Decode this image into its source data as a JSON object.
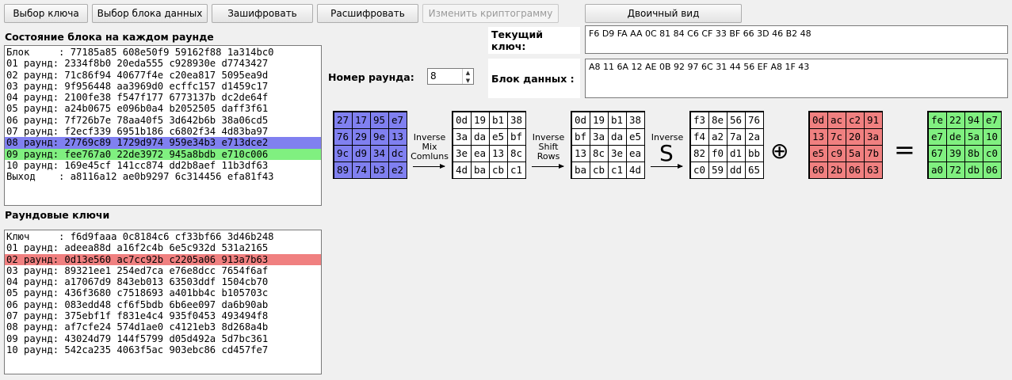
{
  "toolbar": {
    "select_key": "Выбор ключа",
    "select_block": "Выбор блока данных",
    "encrypt": "Зашифровать",
    "decrypt": "Расшифровать",
    "edit_cryptogram": "Изменить криптограмму",
    "binary_view": "Двоичный вид"
  },
  "state_panel": {
    "title": "Состояние блока на каждом раунде",
    "rows": [
      "Блок     : 77185a85 608e50f9 59162f88 1a314bc0",
      "01 раунд: 2334f8b0 20eda555 c928930e d7743427",
      "02 раунд: 71c86f94 40677f4e c20ea817 5095ea9d",
      "03 раунд: 9f956448 aa3969d0 ecffc157 d1459c17",
      "04 раунд: 2100fe38 f547f177 6773137b dc2de64f",
      "05 раунд: a24b0675 e096b0a4 b2052505 daff3f61",
      "06 раунд: 7f726b7e 78aa40f5 3d642b6b 38a06cd5",
      "07 раунд: f2ecf339 6951b186 c6802f34 4d83ba97",
      "08 раунд: 27769c89 1729d974 959e34b3 e713dce2",
      "09 раунд: fee767a0 22de3972 945a8bdb e710c006",
      "10 раунд: 169e45cf 141cc874 dd2b8aef 11b3df63",
      "Выход    : a8116a12 ae0b9297 6c314456 efa81f43"
    ]
  },
  "keys_panel": {
    "title": "Раундовые ключи",
    "rows": [
      "Ключ     : f6d9faaa 0c8184c6 cf33bf66 3d46b248",
      "01 раунд: adeea88d a16f2c4b 6e5c932d 531a2165",
      "02 раунд: 0d13e560 ac7cc92b c2205a06 913a7b63",
      "03 раунд: 89321ee1 254ed7ca e76e8dcc 7654f6af",
      "04 раунд: a17067d9 843eb013 63503ddf 1504cb70",
      "05 раунд: 436f3680 c7518693 a401bb4c b105703c",
      "06 раунд: 083edd48 cf6f5bdb 6b6ee097 da6b90ab",
      "07 раунд: 375ebf1f f831e4c4 935f0453 493494f8",
      "08 раунд: af7cfe24 574d1ae0 c4121eb3 8d268a4b",
      "09 раунд: 43024d79 144f5799 d05d492a 5d7bc361",
      "10 раунд: 542ca235 4063f5ac 903ebc86 cd457fe7"
    ]
  },
  "current_key": {
    "label": "Текущий ключ:",
    "value": "F6 D9 FA AA 0C 81 84 C6 CF 33 BF 66 3D 46 B2 48"
  },
  "data_block": {
    "label": "Блок данных :",
    "value": "A8 11 6A 12 AE 0B 92 97 6C 31 44 56 EF A8 1F 43"
  },
  "round": {
    "label": "Номер раунда:",
    "value": "8"
  },
  "operations": {
    "inv_mix": [
      "Inverse",
      "Mix",
      "Comluns"
    ],
    "inv_shift": [
      "Inverse",
      "Shift",
      "Rows"
    ],
    "inv_sub": "Inverse",
    "sbox_symbol": "S",
    "xor_symbol": "⊕",
    "equals_symbol": "="
  },
  "matrices": {
    "input": [
      [
        "27",
        "17",
        "95",
        "e7"
      ],
      [
        "76",
        "29",
        "9e",
        "13"
      ],
      [
        "9c",
        "d9",
        "34",
        "dc"
      ],
      [
        "89",
        "74",
        "b3",
        "e2"
      ]
    ],
    "after_mix": [
      [
        "0d",
        "19",
        "b1",
        "38"
      ],
      [
        "3a",
        "da",
        "e5",
        "bf"
      ],
      [
        "3e",
        "ea",
        "13",
        "8c"
      ],
      [
        "4d",
        "ba",
        "cb",
        "c1"
      ]
    ],
    "after_shift": [
      [
        "0d",
        "19",
        "b1",
        "38"
      ],
      [
        "bf",
        "3a",
        "da",
        "e5"
      ],
      [
        "13",
        "8c",
        "3e",
        "ea"
      ],
      [
        "ba",
        "cb",
        "c1",
        "4d"
      ]
    ],
    "after_sub": [
      [
        "f3",
        "8e",
        "56",
        "76"
      ],
      [
        "f4",
        "a2",
        "7a",
        "2a"
      ],
      [
        "82",
        "f0",
        "d1",
        "bb"
      ],
      [
        "c0",
        "59",
        "dd",
        "65"
      ]
    ],
    "round_key": [
      [
        "0d",
        "ac",
        "c2",
        "91"
      ],
      [
        "13",
        "7c",
        "20",
        "3a"
      ],
      [
        "e5",
        "c9",
        "5a",
        "7b"
      ],
      [
        "60",
        "2b",
        "06",
        "63"
      ]
    ],
    "output": [
      [
        "fe",
        "22",
        "94",
        "e7"
      ],
      [
        "e7",
        "de",
        "5a",
        "10"
      ],
      [
        "67",
        "39",
        "8b",
        "c0"
      ],
      [
        "a0",
        "72",
        "db",
        "06"
      ]
    ]
  },
  "colors": {
    "blue": "#8080f0",
    "green": "#80f080",
    "red": "#f08080"
  }
}
